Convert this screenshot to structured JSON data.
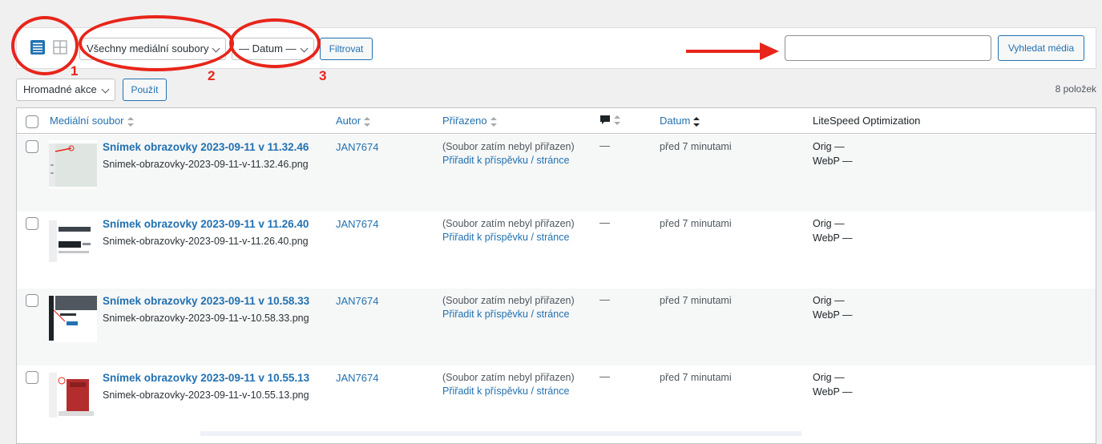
{
  "toolbar": {
    "media_type_filter": "Všechny mediální soubory",
    "date_filter": "— Datum —",
    "filter_button": "Filtrovat",
    "search_placeholder": "",
    "search_button": "Vyhledat média"
  },
  "annotations": [
    "1",
    "2",
    "3"
  ],
  "bulk": {
    "actions_label": "Hromadné akce",
    "apply_button": "Použít",
    "item_count": "8 položek"
  },
  "table": {
    "columns": {
      "file": "Mediální soubor",
      "author": "Autor",
      "attached": "Přiřazeno",
      "comments_icon": "comment-icon",
      "date": "Datum",
      "litespeed": "LiteSpeed Optimization"
    },
    "rows": [
      {
        "title": "Snímek obrazovky 2023-09-11 v 11.32.46",
        "filename": "Snimek-obrazovky-2023-09-11-v-11.32.46.png",
        "author": "JAN7674",
        "attached": "(Soubor zatím nebyl přiřazen)",
        "attach_link": "Přiřadit k příspěvku / stránce",
        "comments": "—",
        "date": "před 7 minutami",
        "orig": "Orig —",
        "webp": "WebP —"
      },
      {
        "title": "Snímek obrazovky 2023-09-11 v 11.26.40",
        "filename": "Snimek-obrazovky-2023-09-11-v-11.26.40.png",
        "author": "JAN7674",
        "attached": "(Soubor zatím nebyl přiřazen)",
        "attach_link": "Přiřadit k příspěvku / stránce",
        "comments": "—",
        "date": "před 7 minutami",
        "orig": "Orig —",
        "webp": "WebP —"
      },
      {
        "title": "Snímek obrazovky 2023-09-11 v 10.58.33",
        "filename": "Snimek-obrazovky-2023-09-11-v-10.58.33.png",
        "author": "JAN7674",
        "attached": "(Soubor zatím nebyl přiřazen)",
        "attach_link": "Přiřadit k příspěvku / stránce",
        "comments": "—",
        "date": "před 7 minutami",
        "orig": "Orig —",
        "webp": "WebP —"
      },
      {
        "title": "Snímek obrazovky 2023-09-11 v 10.55.13",
        "filename": "Snimek-obrazovky-2023-09-11-v-10.55.13.png",
        "author": "JAN7674",
        "attached": "(Soubor zatím nebyl přiřazen)",
        "attach_link": "Přiřadit k příspěvku / stránce",
        "comments": "—",
        "date": "před 7 minutami",
        "orig": "Orig —",
        "webp": "WebP —"
      }
    ]
  },
  "colors": {
    "link": "#2271b1",
    "annotation": "#e8251a",
    "bg": "#f0f0f1"
  }
}
